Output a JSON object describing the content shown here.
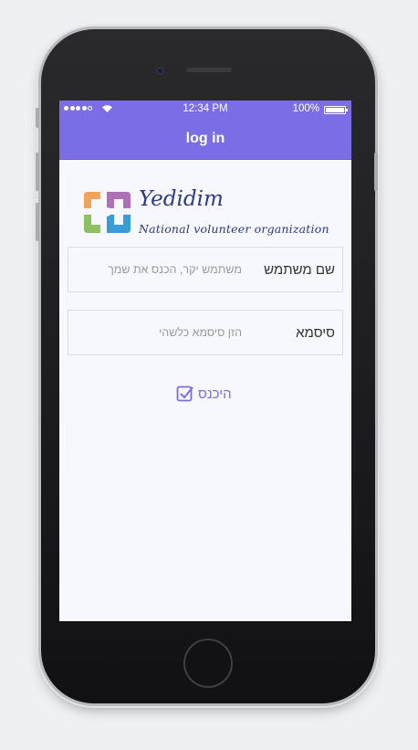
{
  "status": {
    "time": "12:34 PM",
    "battery": "100%"
  },
  "navbar": {
    "title": "log in"
  },
  "brand": {
    "name": "Yedidim",
    "subtitle": "National volunteer organization"
  },
  "form": {
    "username_label": "שם משתמש",
    "username_placeholder": "משתמש יקר, הכנס את שמך",
    "password_label": "סיסמא",
    "password_placeholder": "הזן סיסמא כלשהי",
    "login_label": "היכנס"
  },
  "colors": {
    "accent": "#7a6de6",
    "logo": [
      "#f0a45a",
      "#b06fb9",
      "#8cc063",
      "#3a9bd9"
    ]
  }
}
